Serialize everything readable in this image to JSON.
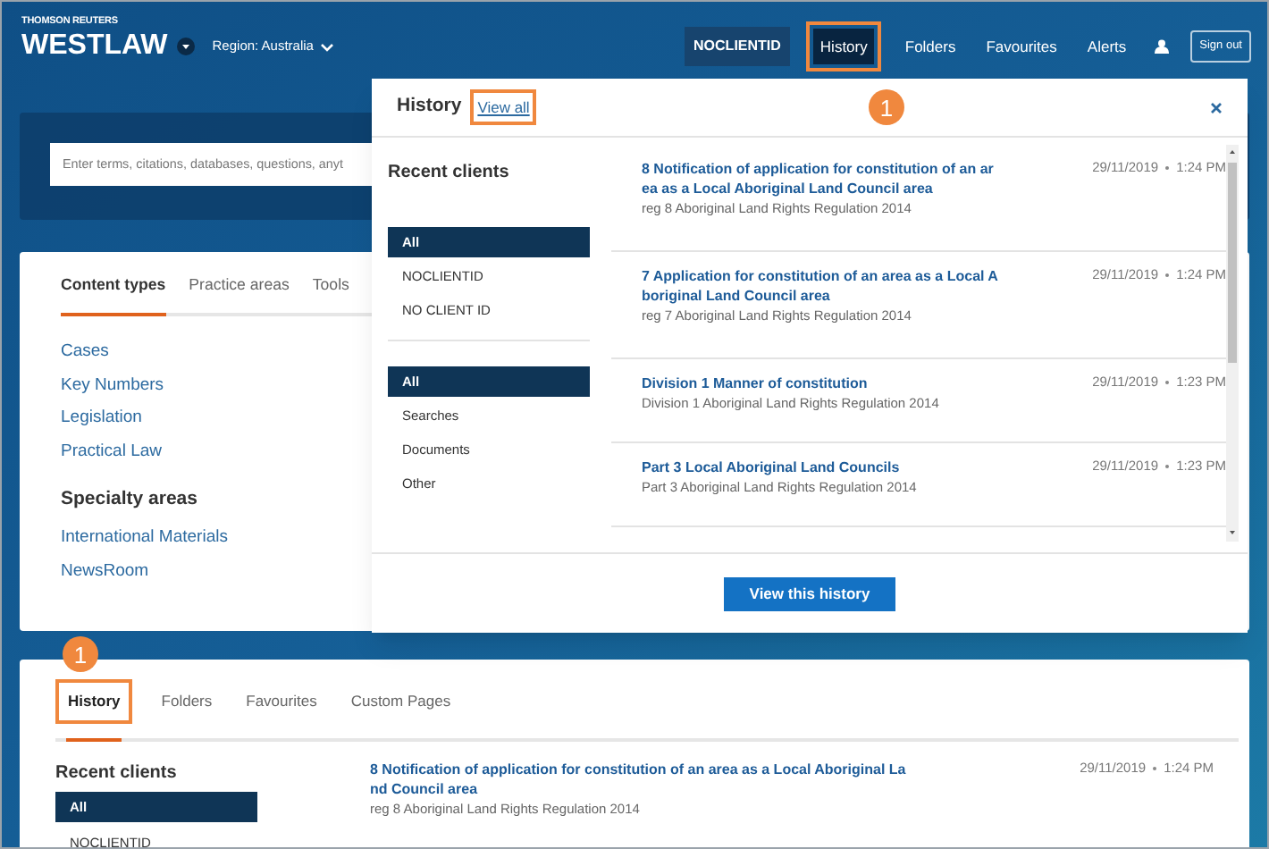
{
  "header": {
    "brand_top": "THOMSON REUTERS",
    "brand": "WESTLAW",
    "region": "Region: Australia",
    "nav": [
      {
        "kind": "client",
        "label": "NOCLIENTID"
      },
      {
        "kind": "link",
        "label": "History",
        "selected": true,
        "highlighted": true
      },
      {
        "kind": "link",
        "label": "Folders",
        "selected": false,
        "highlighted": false
      },
      {
        "kind": "link",
        "label": "Favourites",
        "selected": false,
        "highlighted": false
      },
      {
        "kind": "link",
        "label": "Alerts",
        "selected": false,
        "highlighted": false
      },
      {
        "kind": "user"
      },
      {
        "kind": "button",
        "label": "Sign out"
      }
    ]
  },
  "search": {
    "placeholder": "Enter terms, citations, databases, questions, anyt"
  },
  "content_card": {
    "tabs": [
      {
        "label": "Content types",
        "selected": true
      },
      {
        "label": "Practice areas",
        "selected": false
      },
      {
        "label": "Tools",
        "selected": false
      }
    ],
    "links": [
      "Cases",
      "Key Numbers",
      "Legislation",
      "Practical Law"
    ],
    "specialty_heading": "Specialty areas",
    "specialty_links": [
      "International Materials",
      "NewsRoom"
    ]
  },
  "history_popup": {
    "title": "History",
    "view_all": {
      "label": "View all",
      "highlighted": true
    },
    "callout": "1",
    "recent_clients_heading": "Recent clients",
    "clients": [
      {
        "label": "All",
        "selected": true
      },
      {
        "label": "NOCLIENTID",
        "selected": false
      },
      {
        "label": "NO CLIENT ID",
        "selected": false
      }
    ],
    "types": [
      {
        "label": "All",
        "selected": true
      },
      {
        "label": "Searches",
        "selected": false
      },
      {
        "label": "Documents",
        "selected": false
      },
      {
        "label": "Other",
        "selected": false
      }
    ],
    "items": [
      {
        "title_lines": [
          "8 Notification of application for constitution of an ar",
          "ea as a Local Aboriginal Land Council area"
        ],
        "subtitle": "reg 8 Aboriginal Land Rights Regulation 2014",
        "date": "29/11/2019",
        "time": "1:24 PM"
      },
      {
        "title_lines": [
          "7 Application for constitution of an area as a Local A",
          "boriginal Land Council area"
        ],
        "subtitle": "reg 7 Aboriginal Land Rights Regulation 2014",
        "date": "29/11/2019",
        "time": "1:24 PM"
      },
      {
        "title_lines": [
          "Division 1 Manner of constitution"
        ],
        "subtitle": "Division 1 Aboriginal Land Rights Regulation 2014",
        "date": "29/11/2019",
        "time": "1:23 PM"
      },
      {
        "title_lines": [
          "Part 3 Local Aboriginal Land Councils"
        ],
        "subtitle": "Part 3 Aboriginal Land Rights Regulation 2014",
        "date": "29/11/2019",
        "time": "1:23 PM"
      }
    ],
    "button": "View this history"
  },
  "bottom_card": {
    "callout": "1",
    "tabs": [
      {
        "label": "History",
        "selected": true,
        "highlighted": true
      },
      {
        "label": "Folders",
        "selected": false,
        "highlighted": false
      },
      {
        "label": "Favourites",
        "selected": false,
        "highlighted": false
      },
      {
        "label": "Custom Pages",
        "selected": false,
        "highlighted": false
      }
    ],
    "recent_clients_heading": "Recent clients",
    "clients": [
      {
        "label": "All",
        "selected": true
      },
      {
        "label": "NOCLIENTID",
        "selected": false
      }
    ],
    "items": [
      {
        "title_lines": [
          "8 Notification of application for constitution of an area as a Local Aboriginal La",
          "nd Council area"
        ],
        "subtitle": "reg 8 Aboriginal Land Rights Regulation 2014",
        "date": "29/11/2019",
        "time": "1:24 PM"
      }
    ]
  }
}
